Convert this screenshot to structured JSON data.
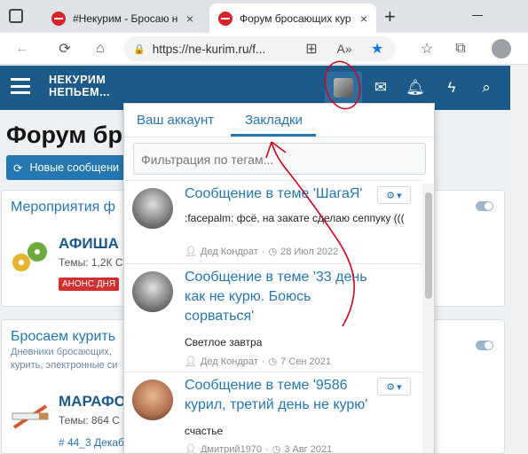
{
  "browser": {
    "tabs": [
      {
        "title": "#Некурим - Бросаю н"
      },
      {
        "title": "Форум бросающих кур"
      }
    ],
    "url": "https://ne-kurim.ru/f..."
  },
  "site": {
    "logo_line1": "НЕКУРИМ",
    "logo_line2": "НЕПЬЕМ..."
  },
  "page": {
    "title": "Форум бр",
    "new_posts_button": "Новые сообщени",
    "block1": {
      "header": "Мероприятия ф",
      "forum_title": "АФИША",
      "forum_stats": "Темы: 1,2К С",
      "badge": "АНОНС ДНЯ"
    },
    "block2": {
      "header": "Бросаем курить",
      "desc_line1": "Дневники бросающих,",
      "desc_line2": "курить, электронные си",
      "forum_title": "МАРАФО",
      "forum_stats": "Темы: 864 С",
      "tag_line": "# 44_3 Декаб"
    }
  },
  "dropdown": {
    "tab_account": "Ваш аккаунт",
    "tab_bookmarks": "Закладки",
    "filter_placeholder": "Фильтрация по тегам...",
    "items": [
      {
        "title": "Сообщение в теме 'ШагаЯ'",
        "body": ":facepalm: фсё, на закате сделаю сеппуку (((",
        "author": "Дед Кондрат",
        "date": "28 Июл 2022"
      },
      {
        "title": "Сообщение в теме '33 день как не курю. Боюсь сорваться'",
        "body": "Светлое завтра",
        "author": "Дед Кондрат",
        "date": "7 Сен 2021"
      },
      {
        "title": "Сообщение в теме '9586 курил, третий день не курю'",
        "body": "счастье",
        "author": "Дмитрий1970",
        "date": "3 Авг 2021"
      }
    ]
  },
  "colors": {
    "header": "#1c5a8a",
    "accent": "#2577b1",
    "annotation": "#d0021b"
  }
}
